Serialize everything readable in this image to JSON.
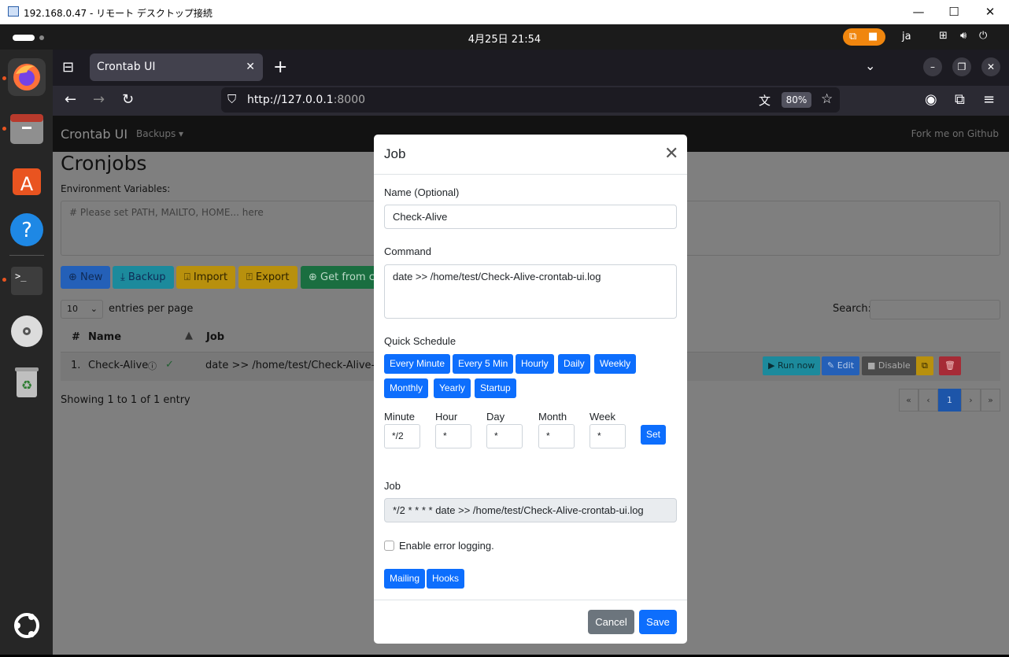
{
  "window": {
    "title": "192.168.0.47 - リモート デスクトップ接続"
  },
  "topbar": {
    "clock": "4月25日  21:54",
    "lang": "ja"
  },
  "browser": {
    "tab_title": "Crontab UI",
    "url_host": "http://127.0.0.1",
    "url_port": ":8000",
    "zoom": "80%"
  },
  "page": {
    "brand": "Crontab UI",
    "backups_menu": "Backups ▾",
    "fork": "Fork me on Github",
    "heading": "Cronjobs",
    "env_label": "Environment Variables:",
    "env_placeholder": "# Please set PATH, MAILTO, HOME... here",
    "buttons": {
      "new": "⊕ New",
      "backup": "⤓ Backup",
      "import": "⍗ Import",
      "export": "⍐ Export",
      "get_from": "⊕ Get from cr"
    },
    "entries_select": "10",
    "entries_label": "entries per page",
    "search_label": "Search:",
    "columns": {
      "num": "#",
      "name": "Name",
      "job": "Job"
    },
    "rows": [
      {
        "num": "1.",
        "name": "Check-Alive",
        "job": "date >> /home/test/Check-Alive-cront"
      }
    ],
    "row_actions": {
      "run": "▶ Run now",
      "edit": "✎ Edit",
      "disable": "■ Disable"
    },
    "showing": "Showing 1 to 1 of 1 entry",
    "pagination": [
      "«",
      "‹",
      "1",
      "›",
      "»"
    ]
  },
  "modal": {
    "title": "Job",
    "name_label": "Name (Optional)",
    "name_value": "Check-Alive",
    "command_label": "Command",
    "command_value": "date >> /home/test/Check-Alive-crontab-ui.log",
    "quick_label": "Quick Schedule",
    "quick": [
      "Every Minute",
      "Every 5 Min",
      "Hourly",
      "Daily",
      "Weekly",
      "Monthly",
      "Yearly",
      "Startup"
    ],
    "fields": {
      "minute": {
        "label": "Minute",
        "value": "*/2"
      },
      "hour": {
        "label": "Hour",
        "value": "*"
      },
      "day": {
        "label": "Day",
        "value": "*"
      },
      "month": {
        "label": "Month",
        "value": "*"
      },
      "week": {
        "label": "Week",
        "value": "*"
      }
    },
    "set": "Set",
    "job_label": "Job",
    "job_value": "*/2 * * * * date >> /home/test/Check-Alive-crontab-ui.log",
    "error_logging": "Enable error logging.",
    "error_logging_checked": false,
    "mailing": "Mailing",
    "hooks": "Hooks",
    "cancel": "Cancel",
    "save": "Save"
  }
}
